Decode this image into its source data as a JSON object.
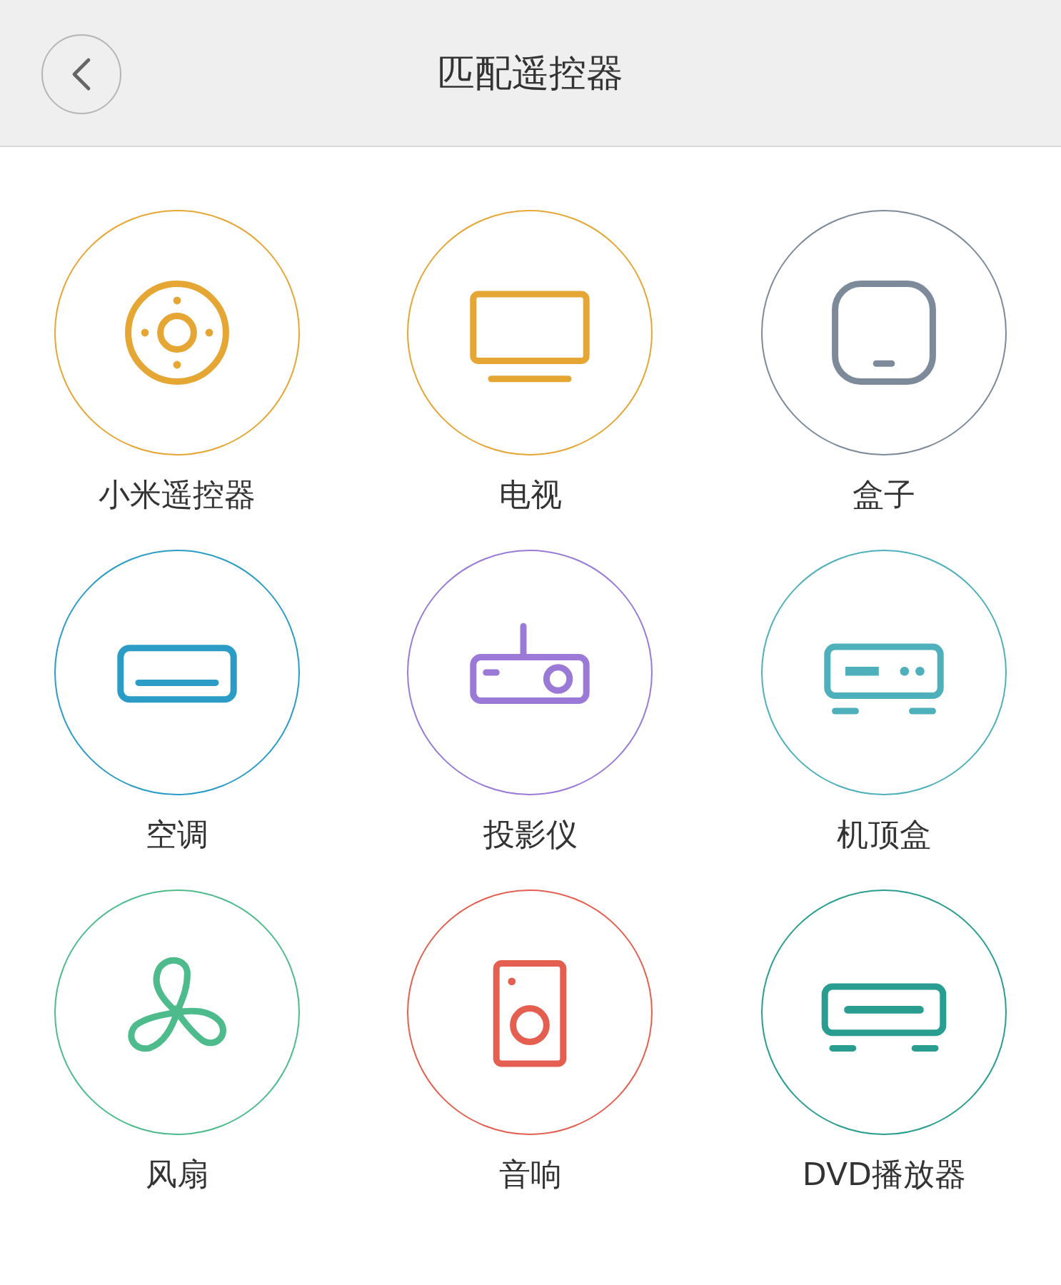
{
  "header": {
    "title": "匹配遥控器"
  },
  "devices": [
    {
      "label": "小米遥控器",
      "kind": "remote",
      "color": "#e5a634"
    },
    {
      "label": "电视",
      "kind": "tv",
      "color": "#e5a634"
    },
    {
      "label": "盒子",
      "kind": "box",
      "color": "#7c8a9a"
    },
    {
      "label": "空调",
      "kind": "ac",
      "color": "#2b9cc5"
    },
    {
      "label": "投影仪",
      "kind": "projector",
      "color": "#9a7ad6"
    },
    {
      "label": "机顶盒",
      "kind": "stb",
      "color": "#4eb0ba"
    },
    {
      "label": "风扇",
      "kind": "fan",
      "color": "#4dbb8b"
    },
    {
      "label": "音响",
      "kind": "speaker",
      "color": "#e45f50"
    },
    {
      "label": "DVD播放器",
      "kind": "dvd",
      "color": "#289d90"
    }
  ]
}
